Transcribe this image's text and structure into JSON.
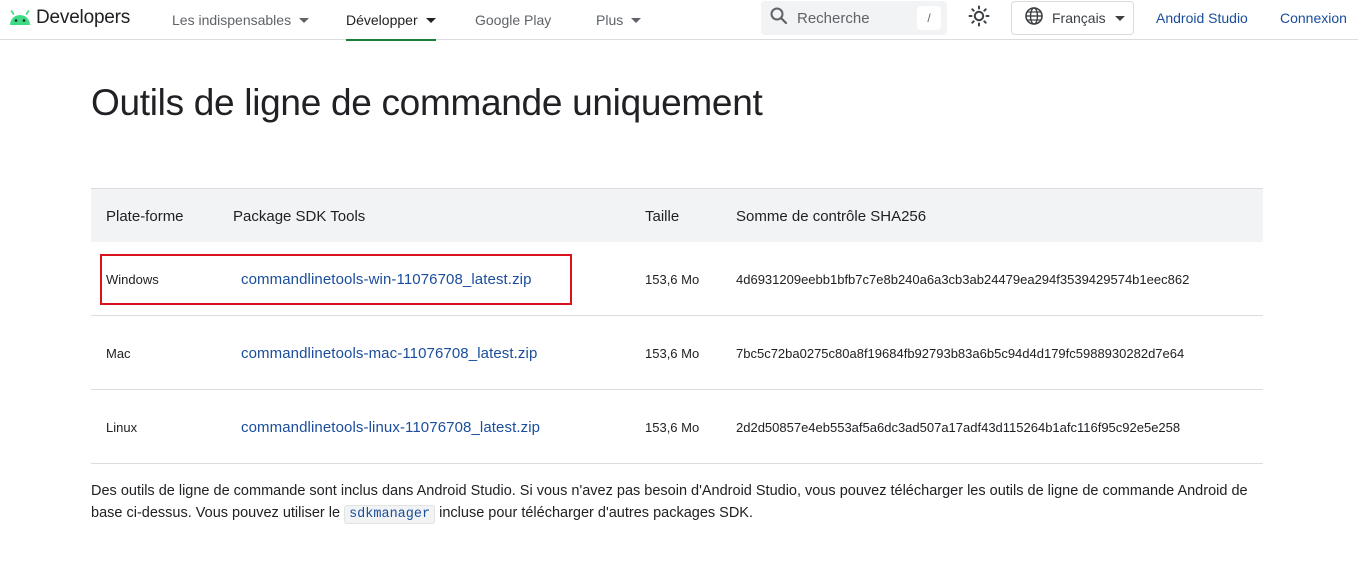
{
  "header": {
    "logo_text": "Developers",
    "nav": [
      {
        "label": "Les indispensables",
        "has_menu": true
      },
      {
        "label": "Développer",
        "has_menu": true,
        "active": true
      },
      {
        "label": "Google Play",
        "has_menu": false
      },
      {
        "label": "Plus",
        "has_menu": true
      }
    ],
    "search": {
      "placeholder": "Recherche",
      "shortcut": "/"
    },
    "language": "Français",
    "links": [
      "Android Studio",
      "Connexion"
    ]
  },
  "page": {
    "title": "Outils de ligne de commande uniquement"
  },
  "table": {
    "headers": [
      "Plate-forme",
      "Package SDK Tools",
      "Taille",
      "Somme de contrôle SHA256"
    ],
    "rows": [
      {
        "platform": "Windows",
        "package": "commandlinetools-win-11076708_latest.zip",
        "size": "153,6 Mo",
        "sha256": "4d6931209eebb1bfb7c7e8b240a6a3cb3ab24479ea294f3539429574b1eec862",
        "highlighted": true
      },
      {
        "platform": "Mac",
        "package": "commandlinetools-mac-11076708_latest.zip",
        "size": "153,6 Mo",
        "sha256": "7bc5c72ba0275c80a8f19684fb92793b83a6b5c94d4d179fc5988930282d7e64",
        "highlighted": false
      },
      {
        "platform": "Linux",
        "package": "commandlinetools-linux-11076708_latest.zip",
        "size": "153,6 Mo",
        "sha256": "2d2d50857e4eb553af5a6dc3ad507a17adf43d115264b1afc116f95c92e5e258",
        "highlighted": false
      }
    ]
  },
  "description": {
    "text_before": "Des outils de ligne de commande sont inclus dans Android Studio. Si vous n'avez pas besoin d'Android Studio, vous pouvez télécharger les outils de ligne de commande Android de base ci-dessus. Vous pouvez utiliser le ",
    "code": "sdkmanager",
    "text_after": " incluse pour télécharger d'autres packages SDK."
  },
  "colors": {
    "link": "#1a4d9c",
    "active_underline": "#188038",
    "highlight_border": "#d9121b",
    "android_green": "#3ddc84"
  },
  "icons": [
    "android-logo-icon",
    "search-icon",
    "theme-toggle-icon",
    "globe-icon",
    "chevron-down-icon"
  ]
}
